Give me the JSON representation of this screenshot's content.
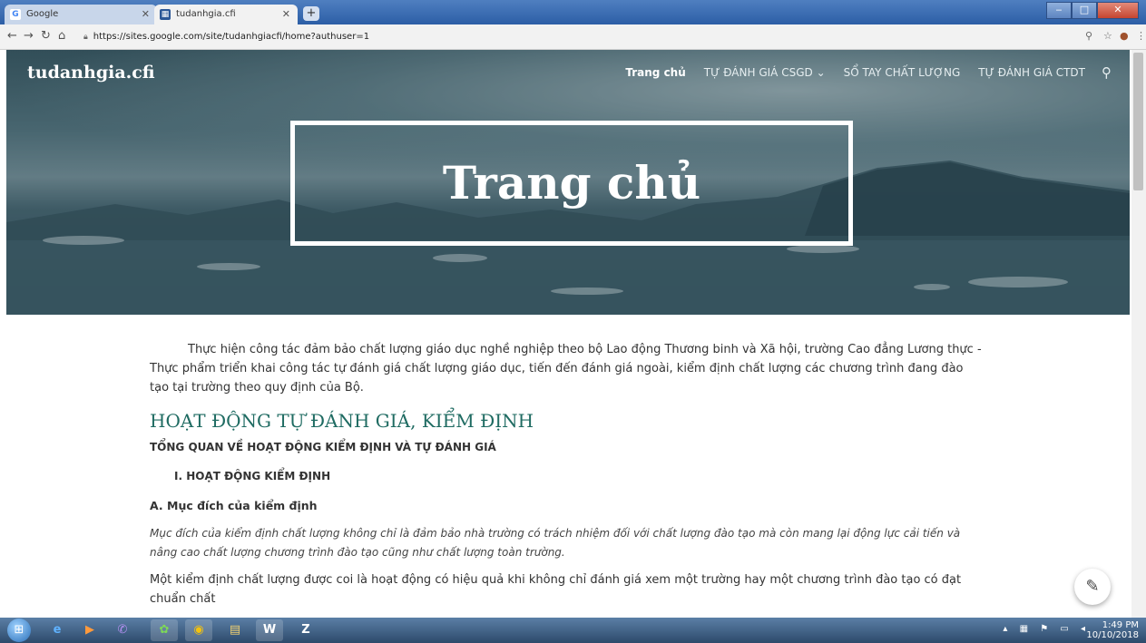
{
  "browser": {
    "tabs": [
      {
        "label": "Google",
        "favicon": "G",
        "active": false
      },
      {
        "label": "tudanhgia.cfi",
        "favicon": "▦",
        "active": true
      }
    ],
    "new_tab_label": "+",
    "url": "https://sites.google.com/site/tudanhgiacfi/home?authuser=1",
    "window_controls": {
      "minimize": "‒",
      "maximize": "□",
      "close": "✕"
    }
  },
  "site": {
    "title": "tudanhgia.cfi",
    "nav": [
      {
        "label": "Trang chủ",
        "current": true
      },
      {
        "label": "TỰ ĐÁNH GIÁ CSGD",
        "dropdown": true
      },
      {
        "label": "SỔ TAY CHẤT LƯỢNG"
      },
      {
        "label": "TỰ ĐÁNH GIÁ CTDT"
      }
    ],
    "dropdown_icon": "⌄",
    "hero_title": "Trang chủ"
  },
  "content": {
    "intro": "Thực hiện công tác đảm bảo chất lượng giáo dục nghề nghiệp theo bộ Lao động Thương binh và Xã hội, trường Cao đẳng Lương thực -Thực phẩm triển khai công tác tự đánh giá chất lượng giáo dục, tiến đến đánh giá ngoài, kiểm định chất lượng các chương trình đang đào tạo tại trường theo quy định của Bộ.",
    "section_heading": "HOẠT ĐỘNG TỰ ĐÁNH GIÁ, KIỂM ĐỊNH",
    "sub_heading": "TỔNG QUAN VỀ HOẠT ĐỘNG KIỂM ĐỊNH VÀ TỰ ĐÁNH GIÁ",
    "item_heading": "I. HOẠT ĐỘNG KIỂM ĐỊNH",
    "a_heading": "A. Mục đích của kiểm định",
    "italic_para": "Mục đích của kiểm định chất lượng không chỉ là đảm bảo nhà trường có trách nhiệm đối với chất lượng đào tạo mà còn mang lại động lực cải tiến và nâng cao chất lượng chương trình đào tạo cũng như chất lượng toàn trường.",
    "body_para": "Một kiểm định chất lượng được coi là hoạt động có hiệu quả khi không chỉ đánh giá xem một trường hay một chương trình đào tạo có đạt chuẩn chất"
  },
  "taskbar": {
    "time": "1:49 PM",
    "date": "10/10/2018",
    "apps": [
      "IE",
      "Media",
      "Viber",
      "Paint",
      "Chrome",
      "Explorer",
      "Word",
      "Zalo"
    ]
  },
  "colors": {
    "heading_accent": "#1f6b62",
    "hero_overlay": "#2f4d5a"
  }
}
